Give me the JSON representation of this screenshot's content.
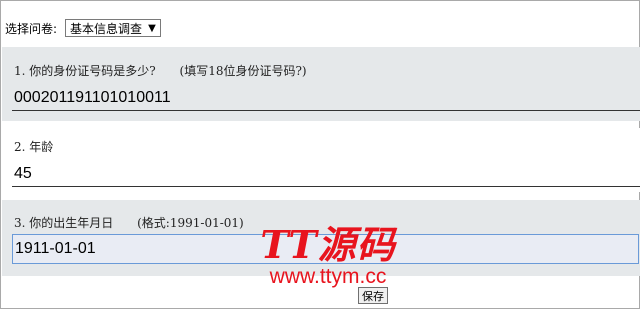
{
  "survey_selector": {
    "label": "选择问卷:",
    "selected": "基本信息调查"
  },
  "questions": [
    {
      "number": "1.",
      "text": "你的身份证号码是多少?",
      "hint": "(填写18位身份证号码?)",
      "answer": "000201191101010011"
    },
    {
      "number": "2.",
      "text": "年龄",
      "hint": "",
      "answer": "45"
    },
    {
      "number": "3.",
      "text": "你的出生年月日",
      "hint": "(格式:1991-01-01)",
      "answer": "1911-01-01"
    }
  ],
  "watermark": {
    "logo": "TT源码",
    "url": "www.ttym.cc"
  },
  "save_button": "保存",
  "colors": {
    "section_bg": "#e5e8ea",
    "focus_border": "#6a9ad8",
    "watermark": "#e8141e"
  }
}
